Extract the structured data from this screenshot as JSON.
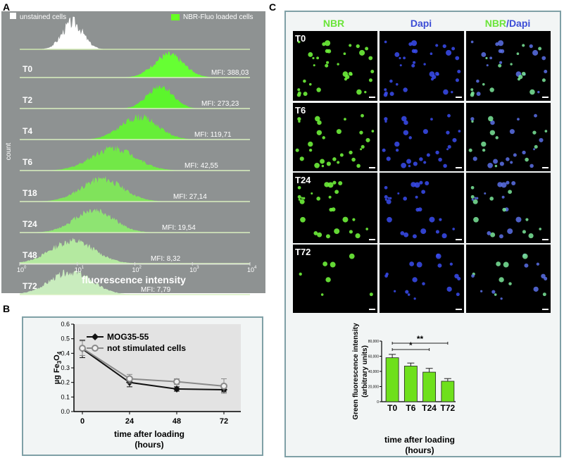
{
  "panels": {
    "a": "A",
    "b": "B",
    "c": "C"
  },
  "flow": {
    "legend": {
      "unstained": "unstained cells",
      "loaded": "NBR-Fluo loaded cells"
    },
    "ylabel": "count",
    "xlabel": "fluorescence intensity",
    "xticks": [
      "10",
      "10",
      "10",
      "10"
    ],
    "xtick_exp": [
      "0",
      "1",
      "2",
      "3",
      "4"
    ],
    "rows": [
      {
        "label": "T0",
        "mfi": "MFI: 388,03"
      },
      {
        "label": "T2",
        "mfi": "MFI: 273,23"
      },
      {
        "label": "T4",
        "mfi": "MFI: 119,71"
      },
      {
        "label": "T6",
        "mfi": "MFI: 42,55"
      },
      {
        "label": "T18",
        "mfi": "MFI: 27,14"
      },
      {
        "label": "T24",
        "mfi": "MFI: 19,54"
      },
      {
        "label": "T48",
        "mfi": "MFI: 8,32"
      },
      {
        "label": "T72",
        "mfi": "MFI: 7,79"
      }
    ]
  },
  "micro": {
    "headers": {
      "nbr": "NBR",
      "dapi": "Dapi",
      "slash": "/"
    },
    "rows": [
      "T0",
      "T6",
      "T24",
      "T72"
    ]
  },
  "chart_data": [
    {
      "type": "line",
      "ylabel": "µg Fe3O4",
      "xlabel": "time after loading (hours)",
      "x": [
        0,
        24,
        48,
        72
      ],
      "ylim": [
        0.0,
        0.6
      ],
      "yticks": [
        "0.0",
        "0.1",
        "0.2",
        "0.3",
        "0.4",
        "0.5",
        "0.6"
      ],
      "series": [
        {
          "name": "MOG35-55",
          "values": [
            0.43,
            0.2,
            0.155,
            0.15
          ],
          "color": "#111111"
        },
        {
          "name": "not stimulated cells",
          "values": [
            0.435,
            0.225,
            0.205,
            0.175
          ],
          "color": "#8a8a8a"
        }
      ]
    },
    {
      "type": "bar",
      "ylabel": "Green fluorescence intensity (arbitrary units)",
      "xlabel": "time after loading (hours)",
      "categories": [
        "T0",
        "T6",
        "T24",
        "T72"
      ],
      "values": [
        58000,
        47000,
        39000,
        27000
      ],
      "ylim": [
        0,
        80000
      ],
      "yticks": [
        "0",
        "20,000",
        "40,000",
        "60,000",
        "80,000"
      ],
      "significance": [
        {
          "from": "T0",
          "to": "T24",
          "label": "*"
        },
        {
          "from": "T0",
          "to": "T72",
          "label": "**"
        }
      ],
      "color": "#6ee01c"
    }
  ]
}
